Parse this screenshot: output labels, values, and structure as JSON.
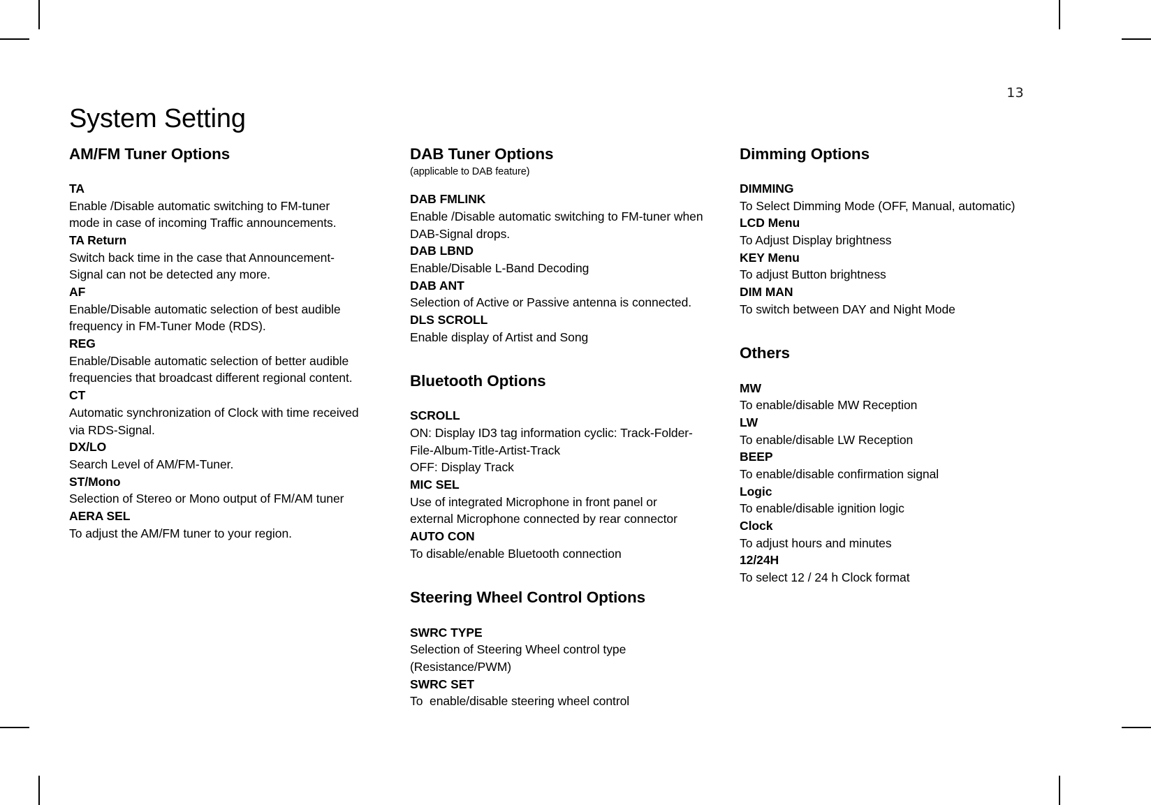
{
  "page": {
    "number": "13",
    "title": "System Setting"
  },
  "columns": [
    {
      "id": "column-1",
      "sections": [
        {
          "id": "am-fm-tuner-options",
          "heading": "AM/FM Tuner Options",
          "subnote": "",
          "entries": [
            {
              "term": "TA",
              "definition": "Enable /Disable automatic switching to FM-tuner mode in case of incoming Traffic announcements."
            },
            {
              "term": "TA Return",
              "definition": "Switch back time in the case that Announcement-Signal can not be detected any more."
            },
            {
              "term": "AF",
              "definition": "Enable/Disable automatic selection of best audible frequency in FM-Tuner Mode (RDS)."
            },
            {
              "term": "REG",
              "definition": "Enable/Disable automatic selection of better audible frequencies that broadcast different regional content."
            },
            {
              "term": "CT",
              "definition": "Automatic synchronization of Clock with time received via RDS-Signal."
            },
            {
              "term": "DX/LO",
              "definition": "Search Level of AM/FM-Tuner."
            },
            {
              "term": "ST/Mono",
              "definition": "Selection of Stereo or Mono output of FM/AM tuner"
            },
            {
              "term": "AERA SEL",
              "definition": "To adjust the AM/FM tuner to your region."
            }
          ]
        }
      ]
    },
    {
      "id": "column-2",
      "sections": [
        {
          "id": "dab-tuner-options",
          "heading": "DAB Tuner Options",
          "subnote": "(applicable to DAB feature)",
          "entries": [
            {
              "term": "DAB FMLINK",
              "definition": "Enable /Disable automatic switching to FM-tuner when DAB-Signal drops."
            },
            {
              "term": "DAB LBND",
              "definition": "Enable/Disable L-Band Decoding"
            },
            {
              "term": "DAB ANT",
              "definition": "Selection of Active or Passive antenna is connected."
            },
            {
              "term": "DLS SCROLL",
              "definition": "Enable display of Artist and Song"
            }
          ]
        },
        {
          "id": "bluetooth-options",
          "heading": "Bluetooth Options",
          "subnote": "",
          "entries": [
            {
              "term": "SCROLL",
              "definition": "ON: Display ID3 tag information cyclic: Track-Folder-File-Album-Title-Artist-Track\nOFF: Display Track"
            },
            {
              "term": "MIC SEL",
              "definition": "Use of integrated Microphone in front panel or external Microphone connected by rear connector"
            },
            {
              "term": "AUTO CON",
              "definition": "To disable/enable Bluetooth connection"
            }
          ]
        },
        {
          "id": "steering-wheel-control-options",
          "heading": "Steering Wheel Control Options",
          "subnote": "",
          "entries": [
            {
              "term": "SWRC TYPE",
              "definition": "Selection of Steering Wheel control type (Resistance/PWM)"
            },
            {
              "term": "SWRC SET",
              "definition": "To  enable/disable steering wheel control"
            }
          ]
        }
      ]
    },
    {
      "id": "column-3",
      "sections": [
        {
          "id": "dimming-options",
          "heading": "Dimming Options",
          "subnote": "",
          "entries": [
            {
              "term": "DIMMING",
              "definition": "To Select Dimming Mode (OFF, Manual, automatic)"
            },
            {
              "term": "LCD Menu",
              "definition": "To Adjust Display brightness"
            },
            {
              "term": "KEY Menu",
              "definition": "To adjust Button brightness"
            },
            {
              "term": "DIM MAN",
              "definition": "To switch between DAY and Night Mode"
            }
          ]
        },
        {
          "id": "others",
          "heading": "Others",
          "subnote": "",
          "entries": [
            {
              "term": "MW",
              "definition": "To enable/disable MW Reception"
            },
            {
              "term": "LW",
              "definition": "To enable/disable LW Reception"
            },
            {
              "term": "BEEP",
              "definition": "To enable/disable confirmation signal"
            },
            {
              "term": "Logic",
              "definition": "To enable/disable ignition logic"
            },
            {
              "term": "Clock",
              "definition": "To adjust hours and minutes"
            },
            {
              "term": "12/24H",
              "definition": "To select 12 / 24 h Clock format"
            }
          ]
        }
      ]
    }
  ]
}
